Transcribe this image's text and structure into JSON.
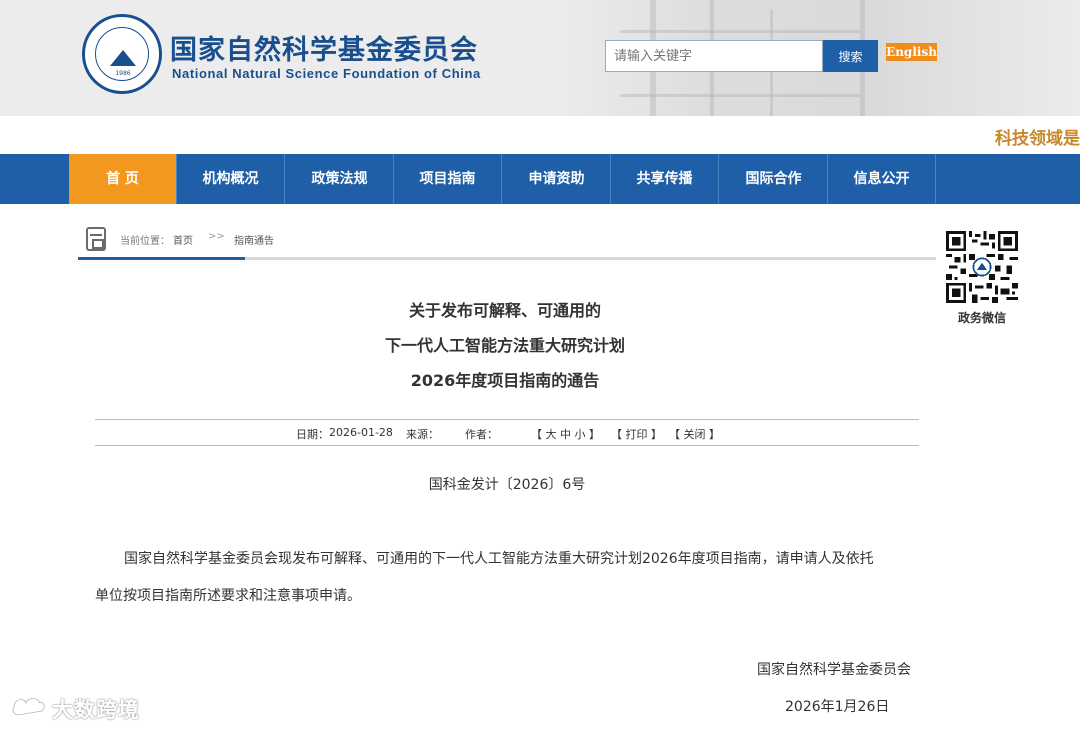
{
  "header": {
    "title_cn": "国家自然科学基金委员会",
    "title_en": "National Natural Science Foundation of China",
    "logo_year": "1986",
    "search_placeholder": "请输入关键字",
    "search_button": "搜索",
    "english_link": "English"
  },
  "ticker": {
    "text": "科技领域是"
  },
  "nav": {
    "items": [
      {
        "label": "首  页"
      },
      {
        "label": "机构概况"
      },
      {
        "label": "政策法规"
      },
      {
        "label": "项目指南"
      },
      {
        "label": "申请资助"
      },
      {
        "label": "共享传播"
      },
      {
        "label": "国际合作"
      },
      {
        "label": "信息公开"
      }
    ]
  },
  "breadcrumb": {
    "label": "当前位置：",
    "home": "首页",
    "separator": ">>",
    "current": "指南通告"
  },
  "qr": {
    "label": "政务微信"
  },
  "article": {
    "title_lines": [
      "关于发布可解释、可通用的",
      "下一代人工智能方法重大研究计划",
      "2026年度项目指南的通告"
    ],
    "meta": {
      "date_label": "日期：",
      "date": "2026-01-28",
      "source_label": "来源：",
      "author_label": "作者：",
      "size_label": "【 大 中 小 】",
      "print_label": "【 打印 】",
      "close_label": "【 关闭 】"
    },
    "doc_number": "国科金发计〔2026〕6号",
    "paragraph_line1": "国家自然科学基金委员会现发布可解释、可通用的下一代人工智能方法重大研究计划2026年度项目指南，请申请人及依托",
    "paragraph_line2": "单位按项目指南所述要求和注意事项申请。",
    "signature_org": "国家自然科学基金委员会",
    "signature_date": "2026年1月26日"
  },
  "watermark": {
    "text": "大数跨境"
  }
}
